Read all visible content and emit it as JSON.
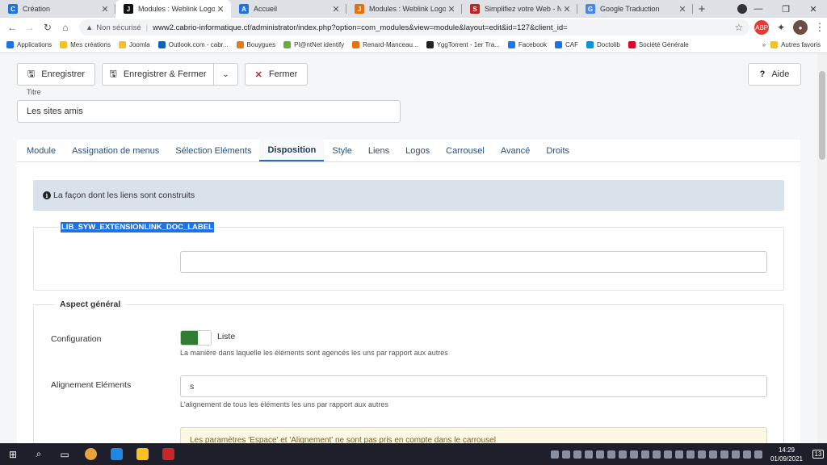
{
  "browser": {
    "tabs": [
      {
        "title": "Création",
        "color": "#1a73e8",
        "letter": "C",
        "active": false
      },
      {
        "title": "Modules : Weblink Logos - Ca",
        "color": "#111111",
        "letter": "J",
        "active": true
      },
      {
        "title": "Accueil",
        "color": "#1a73e8",
        "letter": "A",
        "active": false
      },
      {
        "title": "Modules : Weblink Logos - Ca",
        "color": "#e8710a",
        "letter": "J",
        "active": false
      },
      {
        "title": "Simplifiez votre Web - Nous",
        "color": "#c5221f",
        "letter": "S",
        "active": false
      },
      {
        "title": "Google Traduction",
        "color": "#4285f4",
        "letter": "G",
        "active": false
      }
    ],
    "new_tab": "+",
    "address": {
      "insecure_label": "Non sécurisé",
      "url": "www2.cabrio-informatique.cf/administrator/index.php?option=com_modules&view=module&layout=edit&id=127&client_id="
    },
    "bookmarks": [
      {
        "label": "Applications",
        "color": "#1a73e8"
      },
      {
        "label": "Mes créations",
        "color": "#f6c026"
      },
      {
        "label": "Joomla",
        "color": "#f6c026"
      },
      {
        "label": "Outlook.com - cabr...",
        "color": "#0a64c8"
      },
      {
        "label": "Bouygues",
        "color": "#e57c17"
      },
      {
        "label": "Pl@ntNet identify",
        "color": "#6bab3a"
      },
      {
        "label": "Renard-Manceau...",
        "color": "#e8710a"
      },
      {
        "label": "YggTorrent - 1er Tra...",
        "color": "#222222"
      },
      {
        "label": "Facebook",
        "color": "#1877f2"
      },
      {
        "label": "CAF",
        "color": "#1a73e8"
      },
      {
        "label": "Doctolib",
        "color": "#0596de"
      },
      {
        "label": "Société Générale",
        "color": "#e60028"
      }
    ],
    "bookmarks_more": "»",
    "other_bookmarks": "Autres favoris"
  },
  "toolbar": {
    "save_label": "Enregistrer",
    "save_close_label": "Enregistrer & Fermer",
    "close_label": "Fermer",
    "help_label": "Aide"
  },
  "form": {
    "title_label": "Titre",
    "title_value": "Les sites amis"
  },
  "tabs": [
    {
      "label": "Module",
      "active": false
    },
    {
      "label": "Assignation de menus",
      "active": false
    },
    {
      "label": "Sélection Eléments",
      "active": false
    },
    {
      "label": "Disposition",
      "active": true
    },
    {
      "label": "Style",
      "active": false
    },
    {
      "label": "Liens",
      "active": false
    },
    {
      "label": "Logos",
      "active": false
    },
    {
      "label": "Carrousel",
      "active": false
    },
    {
      "label": "Avancé",
      "active": false
    },
    {
      "label": "Droits",
      "active": false
    }
  ],
  "panel": {
    "info_text": "La façon dont les liens sont construits",
    "doc_label": "LIB_SYW_EXTENSIONLINK_DOC_LABEL",
    "section_title": "Aspect général",
    "config_label": "Configuration",
    "config_value": "Liste",
    "config_desc": "La manière dans laquelle les éléments sont agencés les uns par rapport aux autres",
    "align_label": "Alignement Eléments",
    "align_value": "s",
    "align_desc": "L'alignement de tous les éléments les uns par rapport aux autres",
    "warning_text": "Les paramètres 'Espace' et 'Alignement' ne sont pas pris en compte dans le carrousel"
  },
  "taskbar": {
    "time": "14:29",
    "date": "01/09/2021",
    "notifications": "13"
  }
}
